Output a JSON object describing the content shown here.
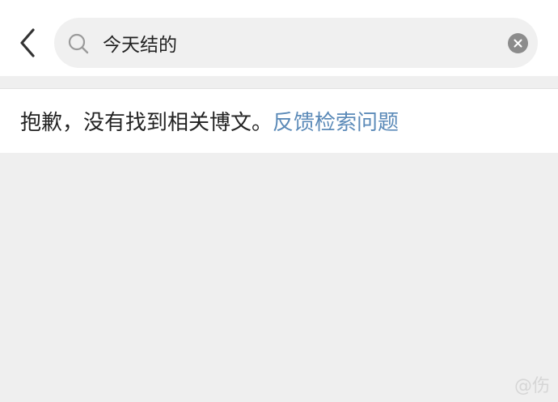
{
  "search": {
    "value": "今天结的"
  },
  "results": {
    "empty_message": "抱歉，没有找到相关博文。",
    "feedback_link": "反馈检索问题"
  },
  "watermark": "@伤",
  "colors": {
    "link": "#5b8ab8",
    "background": "#efefef",
    "search_box": "#f0f0f0",
    "clear_button": "#8c8c8c"
  },
  "icons": {
    "back": "chevron-left-icon",
    "search": "search-icon",
    "clear": "close-icon"
  }
}
